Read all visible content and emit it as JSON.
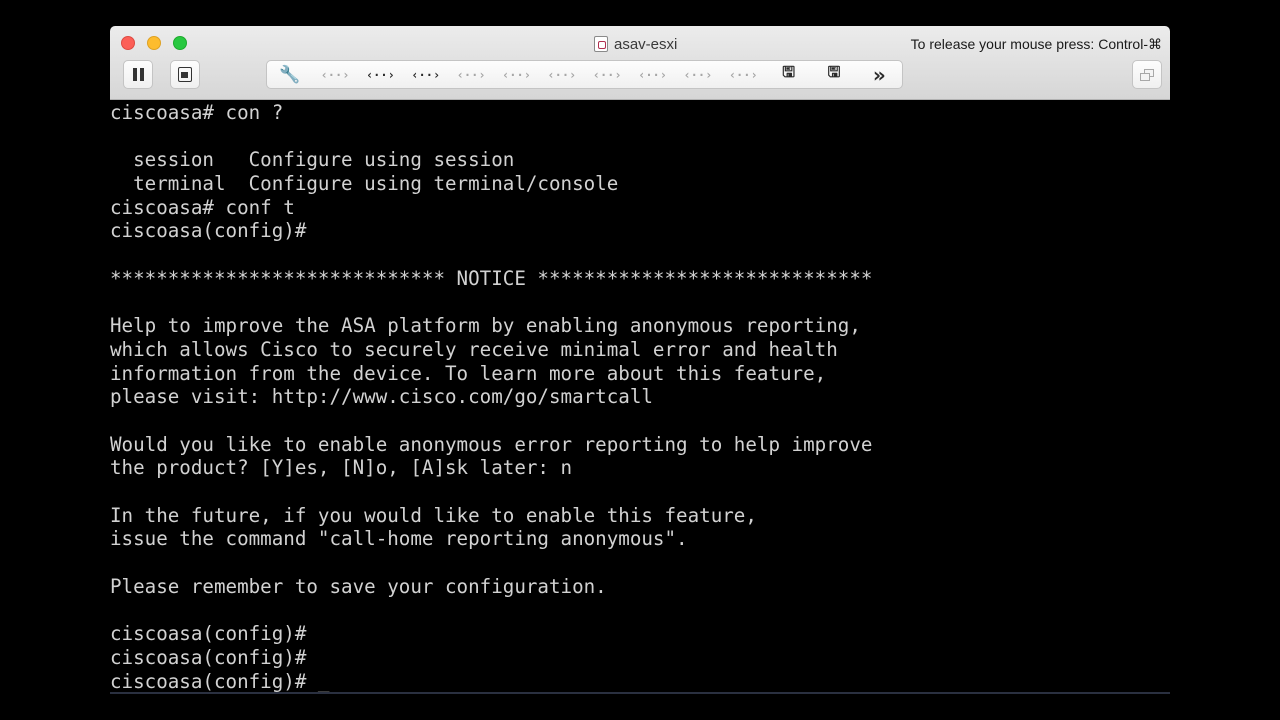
{
  "window": {
    "title": "asav-esxi",
    "release_hint": "To release your mouse press: Control-⌘"
  },
  "toolbar": {
    "pause_icon": "pause-icon",
    "snapshot_icon": "snapshot-icon",
    "restore_icon": "restore-window-icon",
    "items": [
      {
        "name": "settings-wrench-icon",
        "glyph": "🔧",
        "enabled": true
      },
      {
        "name": "network-adapter-1-icon",
        "glyph": "‹··›",
        "enabled": false
      },
      {
        "name": "network-adapter-2-icon",
        "glyph": "‹··›",
        "enabled": true
      },
      {
        "name": "network-adapter-3-icon",
        "glyph": "‹··›",
        "enabled": true
      },
      {
        "name": "network-adapter-4-icon",
        "glyph": "‹··›",
        "enabled": false
      },
      {
        "name": "network-adapter-5-icon",
        "glyph": "‹··›",
        "enabled": false
      },
      {
        "name": "network-adapter-6-icon",
        "glyph": "‹··›",
        "enabled": false
      },
      {
        "name": "network-adapter-7-icon",
        "glyph": "‹··›",
        "enabled": false
      },
      {
        "name": "network-adapter-8-icon",
        "glyph": "‹··›",
        "enabled": false
      },
      {
        "name": "network-adapter-9-icon",
        "glyph": "‹··›",
        "enabled": false
      },
      {
        "name": "network-adapter-10-icon",
        "glyph": "‹··›",
        "enabled": false
      },
      {
        "name": "disk-1-icon",
        "glyph": "🖫",
        "enabled": true
      },
      {
        "name": "disk-2-icon",
        "glyph": "🖫",
        "enabled": true
      },
      {
        "name": "more-chevron-icon",
        "glyph": "»",
        "enabled": true
      }
    ]
  },
  "console": {
    "lines": [
      "ciscoasa# con ?",
      "",
      "  session   Configure using session",
      "  terminal  Configure using terminal/console",
      "ciscoasa# conf t",
      "ciscoasa(config)#",
      "",
      "***************************** NOTICE *****************************",
      "",
      "Help to improve the ASA platform by enabling anonymous reporting,",
      "which allows Cisco to securely receive minimal error and health",
      "information from the device. To learn more about this feature,",
      "please visit: http://www.cisco.com/go/smartcall",
      "",
      "Would you like to enable anonymous error reporting to help improve",
      "the product? [Y]es, [N]o, [A]sk later: n",
      "",
      "In the future, if you would like to enable this feature,",
      "issue the command \"call-home reporting anonymous\".",
      "",
      "Please remember to save your configuration.",
      "",
      "ciscoasa(config)#",
      "ciscoasa(config)#",
      "ciscoasa(config)# _"
    ]
  }
}
